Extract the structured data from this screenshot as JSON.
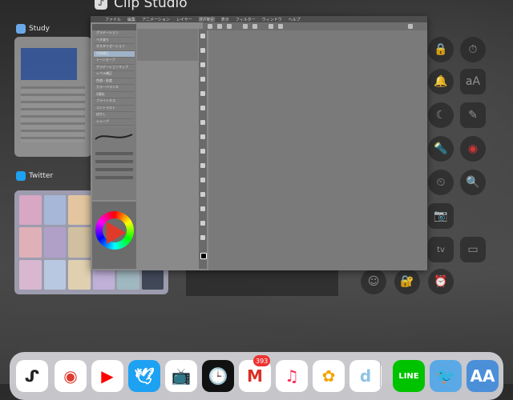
{
  "app_switcher": {
    "front_app_title": "Clip Studio",
    "cards": [
      {
        "label": "Study"
      },
      {
        "label": "Twitter"
      }
    ]
  },
  "clip_studio": {
    "menu": [
      "ファイル",
      "編集",
      "アニメーション",
      "レイヤー",
      "選択範囲",
      "表示",
      "フィルター",
      "ウィンドウ",
      "ヘルプ"
    ],
    "subtool_rows": [
      "グラデーション",
      "ベタ塗り",
      "ポスタリゼーション",
      "色調補正",
      "トーンカーブ",
      "グラデーションマップ",
      "レベル補正",
      "色相・彩度",
      "カラーバランス",
      "2値化",
      "ブライトネス",
      "コントラスト",
      "ぼかし",
      "シャープ"
    ]
  },
  "dock": {
    "apps": [
      {
        "name": "Clip Studio Paint",
        "icon": "clip-studio-icon",
        "bg": "#ffffff",
        "fg": "#222222",
        "glyph": "ᔑ"
      },
      {
        "name": "Chrome",
        "icon": "chrome-icon",
        "bg": "#ffffff",
        "fg": "#dd3b2f",
        "glyph": "◉"
      },
      {
        "name": "YouTube",
        "icon": "youtube-icon",
        "bg": "#ffffff",
        "fg": "#ff0000",
        "glyph": "▶"
      },
      {
        "name": "Twitter",
        "icon": "twitter-icon",
        "bg": "#1da1f2",
        "fg": "#ffffff",
        "glyph": "🕊"
      },
      {
        "name": "TV",
        "icon": "tv-icon",
        "bg": "#ffffff",
        "fg": "#333333",
        "glyph": "📺"
      },
      {
        "name": "Clock",
        "icon": "clock-icon",
        "bg": "#111111",
        "fg": "#ffffff",
        "glyph": "🕒"
      },
      {
        "name": "Gmail",
        "icon": "gmail-icon",
        "bg": "#ffffff",
        "fg": "#d93025",
        "glyph": "M"
      },
      {
        "name": "Music",
        "icon": "music-icon",
        "bg": "#ffffff",
        "fg": "#fa2d55",
        "glyph": "♫"
      },
      {
        "name": "Photos",
        "icon": "photos-icon",
        "bg": "#ffffff",
        "fg": "#f4a300",
        "glyph": "✿"
      },
      {
        "name": "d",
        "icon": "d-app-icon",
        "bg": "#ffffff",
        "fg": "#8fc3e6",
        "glyph": "d"
      },
      {
        "name": "LINE",
        "icon": "line-icon",
        "bg": "#00c300",
        "fg": "#ffffff",
        "glyph": "LINE"
      },
      {
        "name": "Live Bird",
        "icon": "bird-app-icon",
        "bg": "#5aa9e6",
        "fg": "#ffffff",
        "glyph": "🐦"
      },
      {
        "name": "AA",
        "icon": "aa-app-icon",
        "bg": "#4a8fd8",
        "fg": "#ffffff",
        "glyph": "AA"
      }
    ],
    "gmail_badge": "393"
  },
  "control_center": {
    "items": [
      "lock-rotation-icon",
      "timer-icon",
      "bell-icon",
      "text-size-icon",
      "moon-icon",
      "note-icon",
      "flashlight-icon",
      "record-icon",
      "stopwatch-icon",
      "magnifier-icon",
      "camera-icon",
      "appletv-icon",
      "accessibility-icon",
      "guided-access-icon",
      "alarm-icon"
    ]
  }
}
